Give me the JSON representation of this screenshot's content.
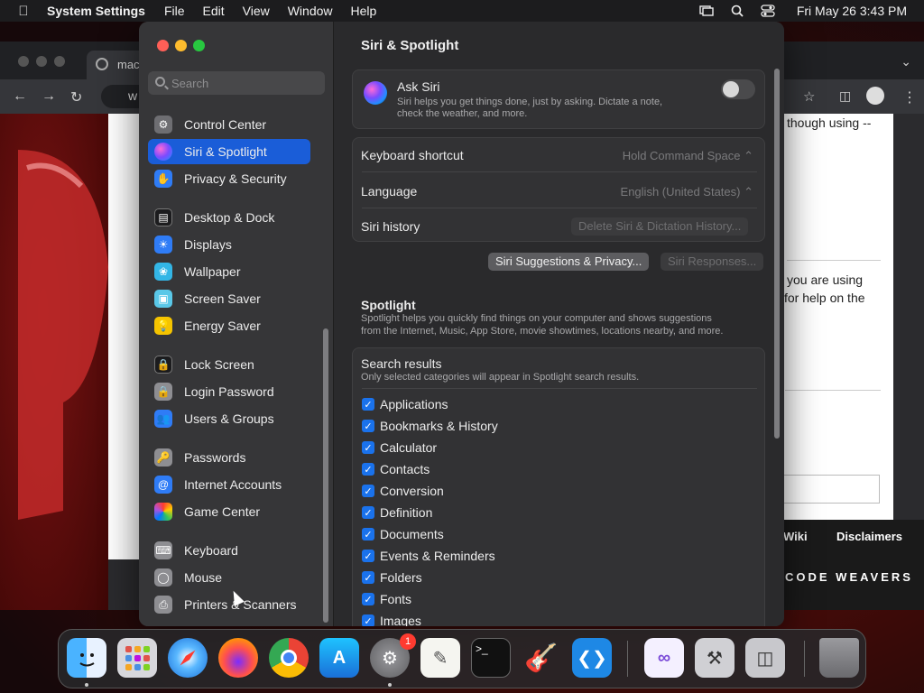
{
  "menubar": {
    "app_name": "System Settings",
    "menus": [
      "File",
      "Edit",
      "View",
      "Window",
      "Help"
    ],
    "clock": "Fri May 26  3:43 PM"
  },
  "browser": {
    "tab_title": "mac",
    "address_fragment": "w",
    "page_snippets": {
      "line1": "though using --",
      "line2": "you are using",
      "line3": "for help on the"
    },
    "footer_links": [
      "Wiki",
      "Disclaimers"
    ],
    "brand": "CODE WEAVERS"
  },
  "sidebar": {
    "search_placeholder": "Search",
    "items": [
      {
        "label": "Control Center",
        "icon": "control-center-icon",
        "color": "#6e6e72"
      },
      {
        "label": "Siri & Spotlight",
        "icon": "siri-icon",
        "color": "#7b4bff",
        "selected": true
      },
      {
        "label": "Privacy & Security",
        "icon": "hand-icon",
        "color": "#2f7cf6"
      },
      {
        "label": "Desktop & Dock",
        "icon": "desktop-dock-icon",
        "color": "#1c1c1e"
      },
      {
        "label": "Displays",
        "icon": "displays-icon",
        "color": "#2f7cf6"
      },
      {
        "label": "Wallpaper",
        "icon": "wallpaper-icon",
        "color": "#33b6e6"
      },
      {
        "label": "Screen Saver",
        "icon": "screen-saver-icon",
        "color": "#5ac8e8"
      },
      {
        "label": "Energy Saver",
        "icon": "energy-saver-icon",
        "color": "#f5c400"
      },
      {
        "label": "Lock Screen",
        "icon": "lock-icon",
        "color": "#1c1c1e"
      },
      {
        "label": "Login Password",
        "icon": "login-lock-icon",
        "color": "#8e8e92"
      },
      {
        "label": "Users & Groups",
        "icon": "users-icon",
        "color": "#2f7cf6"
      },
      {
        "label": "Passwords",
        "icon": "key-icon",
        "color": "#8e8e92"
      },
      {
        "label": "Internet Accounts",
        "icon": "at-icon",
        "color": "#2f7cf6"
      },
      {
        "label": "Game Center",
        "icon": "game-center-icon",
        "color": "#e040a0"
      },
      {
        "label": "Keyboard",
        "icon": "keyboard-icon",
        "color": "#8e8e92"
      },
      {
        "label": "Mouse",
        "icon": "mouse-icon",
        "color": "#8e8e92"
      },
      {
        "label": "Printers & Scanners",
        "icon": "printer-icon",
        "color": "#8e8e92"
      }
    ]
  },
  "main": {
    "title": "Siri & Spotlight",
    "ask_siri": {
      "label": "Ask Siri",
      "description_line1": "Siri helps you get things done, just by asking. Dictate a note,",
      "description_line2": "check the weather, and more.",
      "enabled": false
    },
    "keyboard_shortcut": {
      "label": "Keyboard shortcut",
      "value": "Hold Command Space"
    },
    "language": {
      "label": "Language",
      "value": "English (United States)"
    },
    "siri_history": {
      "label": "Siri history",
      "button": "Delete Siri & Dictation History..."
    },
    "buttons": {
      "suggestions": "Siri Suggestions & Privacy...",
      "responses": "Siri Responses..."
    },
    "spotlight": {
      "heading": "Spotlight",
      "description_line1": "Spotlight helps you quickly find things on your computer and shows suggestions",
      "description_line2": "from the Internet, Music, App Store, movie showtimes, locations nearby, and more."
    },
    "search_results": {
      "heading": "Search results",
      "description": "Only selected categories will appear in Spotlight search results.",
      "categories": [
        "Applications",
        "Bookmarks & History",
        "Calculator",
        "Contacts",
        "Conversion",
        "Definition",
        "Documents",
        "Events & Reminders",
        "Folders",
        "Fonts",
        "Images"
      ]
    }
  },
  "dock": {
    "apps": [
      "finder-icon",
      "launchpad-icon",
      "safari-icon",
      "firefox-icon",
      "chrome-icon",
      "app-store-icon",
      "system-settings-icon",
      "textedit-icon",
      "terminal-icon",
      "garageband-icon",
      "vscode-icon",
      "visual-studio-icon",
      "disk-utility-icon",
      "archive-utility-icon",
      "trash-icon"
    ],
    "badge": "1"
  }
}
